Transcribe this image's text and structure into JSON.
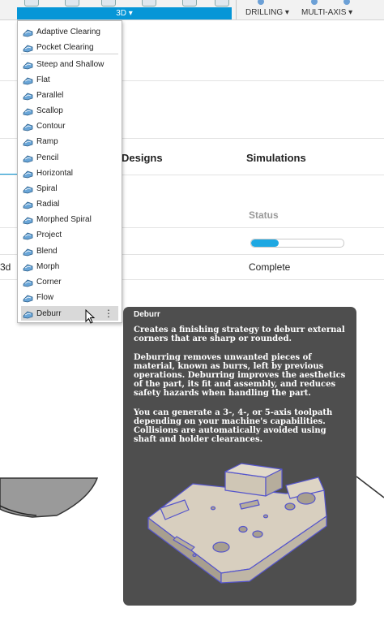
{
  "toolbar": {
    "active_tab": "3D ▾",
    "drilling": "DRILLING ▾",
    "multi_axis": "MULTI-AXIS ▾"
  },
  "background": {
    "designs": "Designs",
    "simulations": "Simulations",
    "status_header": "Status",
    "row_prefix": "3d",
    "status_value": "Complete",
    "progress_fraction": 0.3
  },
  "menu": {
    "items": [
      {
        "label": "Adaptive Clearing",
        "icon": "adaptive-clearing-icon"
      },
      {
        "label": "Pocket Clearing",
        "icon": "pocket-clearing-icon"
      },
      {
        "label": "Steep and Shallow",
        "icon": "steep-and-shallow-icon"
      },
      {
        "label": "Flat",
        "icon": "flat-icon"
      },
      {
        "label": "Parallel",
        "icon": "parallel-icon"
      },
      {
        "label": "Scallop",
        "icon": "scallop-icon"
      },
      {
        "label": "Contour",
        "icon": "contour-icon"
      },
      {
        "label": "Ramp",
        "icon": "ramp-icon"
      },
      {
        "label": "Pencil",
        "icon": "pencil-icon"
      },
      {
        "label": "Horizontal",
        "icon": "horizontal-icon"
      },
      {
        "label": "Spiral",
        "icon": "spiral-icon"
      },
      {
        "label": "Radial",
        "icon": "radial-icon"
      },
      {
        "label": "Morphed Spiral",
        "icon": "morphed-spiral-icon"
      },
      {
        "label": "Project",
        "icon": "project-icon"
      },
      {
        "label": "Blend",
        "icon": "blend-icon"
      },
      {
        "label": "Morph",
        "icon": "morph-icon"
      },
      {
        "label": "Corner",
        "icon": "corner-icon"
      },
      {
        "label": "Flow",
        "icon": "flow-icon"
      },
      {
        "label": "Deburr",
        "icon": "deburr-icon"
      }
    ],
    "kebab": "⋮"
  },
  "tooltip": {
    "title": "Deburr",
    "p1": "Creates a finishing strategy to deburr external corners that are sharp or rounded.",
    "p2": "Deburring removes unwanted pieces of material, known as burrs, left by previous operations. Deburring improves the aesthetics of the part, its fit and assembly, and reduces safety hazards when handling the part.",
    "p3": "You can generate a 3-, 4-, or 5-axis toolpath depending on your machine's capabilities. Collisions are automatically avoided using shaft and holder clearances."
  },
  "colors": {
    "accent": "#0696d7",
    "progress": "#1ea8e2",
    "tooltip_bg": "#4e4e4e",
    "part_edge": "#5555cc"
  }
}
